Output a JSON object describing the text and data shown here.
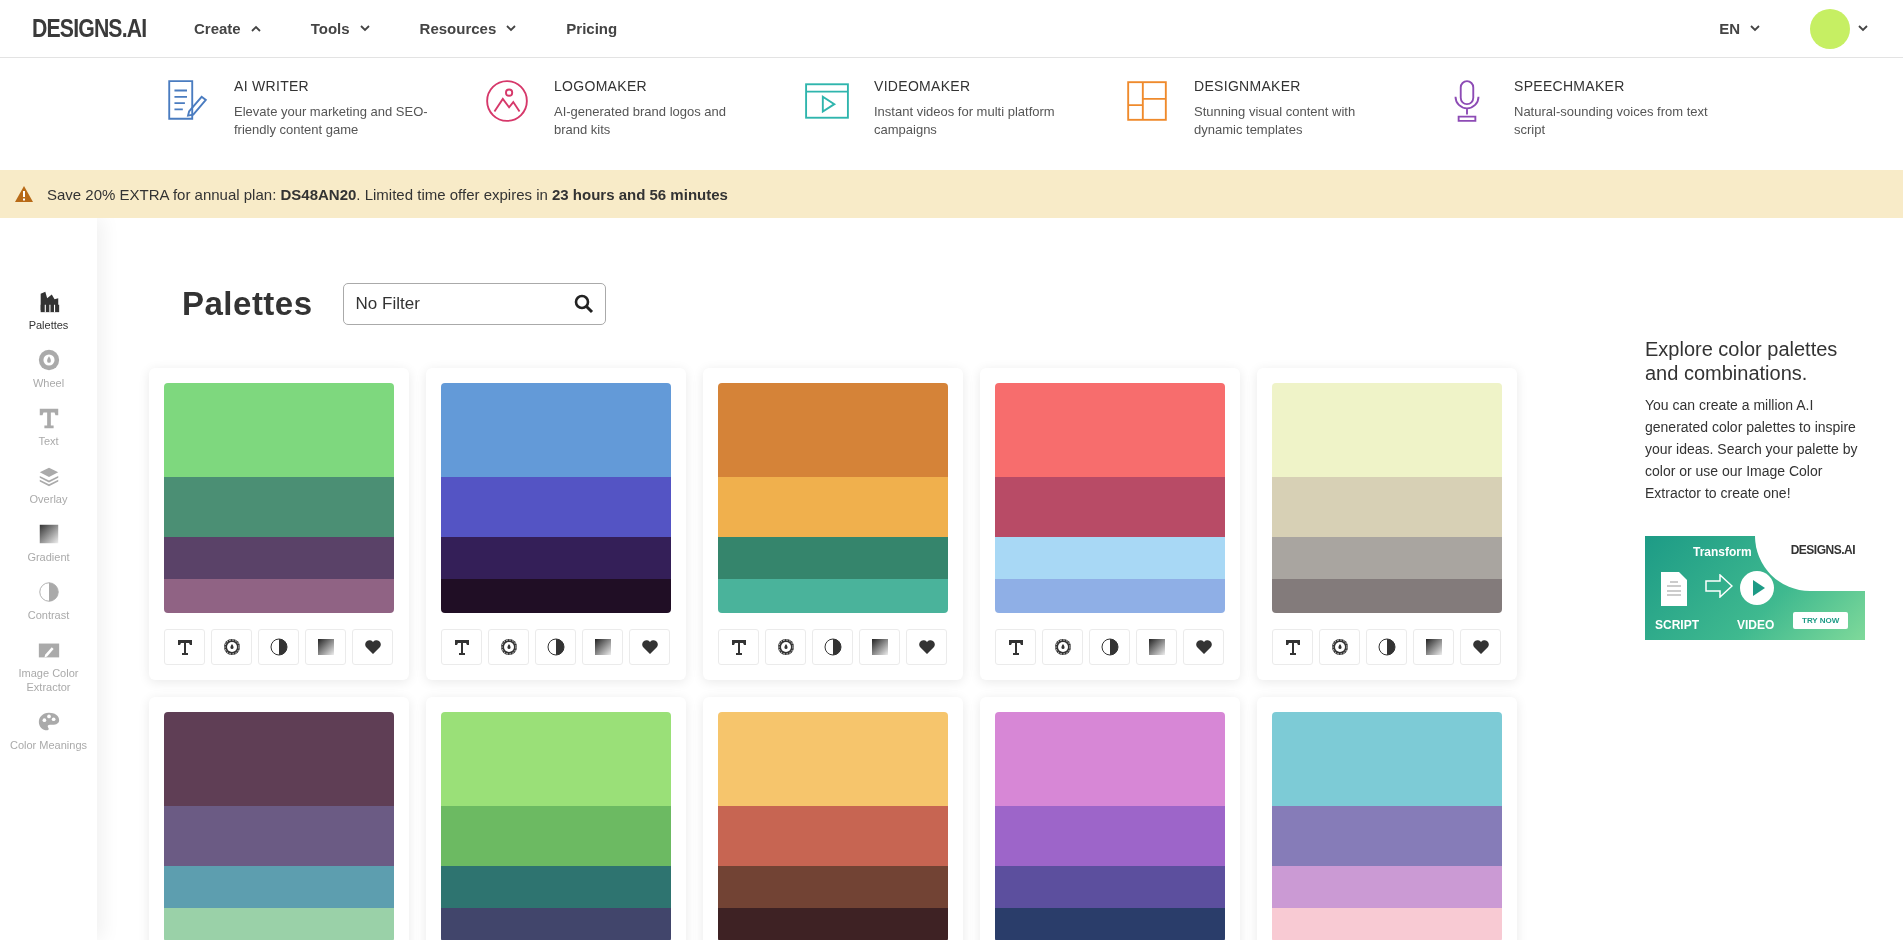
{
  "header": {
    "logo": "DESIGNS.AI",
    "nav": [
      {
        "label": "Create",
        "expanded": true
      },
      {
        "label": "Tools",
        "expanded": false
      },
      {
        "label": "Resources",
        "expanded": false
      },
      {
        "label": "Pricing"
      }
    ],
    "language": "EN"
  },
  "products": [
    {
      "title": "AI WRITER",
      "description": "Elevate your marketing and SEO-friendly content game",
      "color": "#4a7cc0"
    },
    {
      "title": "LOGOMAKER",
      "description": "AI-generated brand logos and brand kits",
      "color": "#d6386a"
    },
    {
      "title": "VIDEOMAKER",
      "description": "Instant videos for multi platform campaigns",
      "color": "#2fb5ad"
    },
    {
      "title": "DESIGNMAKER",
      "description": "Stunning visual content with dynamic templates",
      "color": "#ef8a2c"
    },
    {
      "title": "SPEECHMAKER",
      "description": "Natural-sounding voices from text script",
      "color": "#8d4bb5"
    }
  ],
  "promo": {
    "text": "Save 20% EXTRA for annual plan: **DS48AN20**. Limited time offer expires in **23 hours and 56 minutes**"
  },
  "sidebar": {
    "items": [
      {
        "label": "Palettes",
        "selected": true
      },
      {
        "label": "Wheel",
        "selected": false
      },
      {
        "label": "Text",
        "selected": false
      },
      {
        "label": "Overlay",
        "selected": false
      },
      {
        "label": "Gradient",
        "selected": false
      },
      {
        "label": "Contrast",
        "selected": false
      },
      {
        "label": "Image Color Extractor",
        "selected": false
      },
      {
        "label": "Color Meanings",
        "selected": false
      }
    ]
  },
  "main": {
    "title": "Palettes",
    "search": {
      "value": "No Filter"
    }
  },
  "palettes": [
    {
      "bands": [
        {
          "color": "#7ed87e"
        },
        {
          "color": "#4b8f74"
        },
        {
          "color": "#5a4268"
        },
        {
          "color": "#906384"
        }
      ]
    },
    {
      "bands": [
        {
          "color": "#639ad8"
        },
        {
          "color": "#5454c4"
        },
        {
          "color": "#341f58"
        },
        {
          "color": "#200e25"
        }
      ]
    },
    {
      "bands": [
        {
          "color": "#d58338"
        },
        {
          "color": "#f0b04d"
        },
        {
          "color": "#35856c"
        },
        {
          "color": "#4ab39b"
        }
      ]
    },
    {
      "bands": [
        {
          "color": "#f76d6d"
        },
        {
          "color": "#b84b66"
        },
        {
          "color": "#a8d8f5"
        },
        {
          "color": "#8fafe6"
        }
      ]
    },
    {
      "bands": [
        {
          "color": "#eff3c8"
        },
        {
          "color": "#d7d0b5"
        },
        {
          "color": "#a9a5a0"
        },
        {
          "color": "#837b7b"
        }
      ]
    },
    {
      "bands": [
        {
          "color": "#5f3e55"
        },
        {
          "color": "#6b5b84"
        },
        {
          "color": "#5d9eaf"
        },
        {
          "color": "#9ad1a8"
        }
      ]
    },
    {
      "bands": [
        {
          "color": "#9ae078"
        },
        {
          "color": "#6cba62"
        },
        {
          "color": "#2e7470"
        },
        {
          "color": "#41456b"
        }
      ]
    },
    {
      "bands": [
        {
          "color": "#f6c56c"
        },
        {
          "color": "#c76552"
        },
        {
          "color": "#724334"
        },
        {
          "color": "#3e2224"
        }
      ]
    },
    {
      "bands": [
        {
          "color": "#d787d6"
        },
        {
          "color": "#9d65c9"
        },
        {
          "color": "#5c4f9e"
        },
        {
          "color": "#2a3d6a"
        }
      ]
    },
    {
      "bands": [
        {
          "color": "#7dcbd6"
        },
        {
          "color": "#867cb8"
        },
        {
          "color": "#cb9ad4"
        },
        {
          "color": "#f8cad3"
        }
      ]
    }
  ],
  "info": {
    "title": "Explore color palettes and combinations.",
    "body": "You can create a million A.I generated color palettes to inspire your ideas. Search your palette by color or use our Image Color Extractor to create one!",
    "ad": {
      "heading": "Transform",
      "logo": "DESIGNS.AI",
      "from_label": "SCRIPT",
      "to_label": "VIDEO",
      "button": "TRY NOW"
    }
  }
}
